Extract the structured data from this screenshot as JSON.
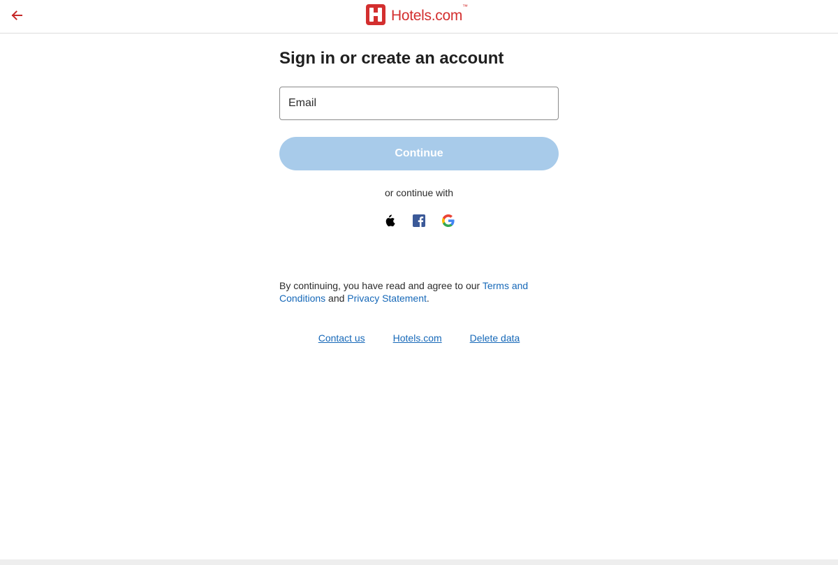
{
  "header": {
    "logo_text": "Hotels.com",
    "logo_tm": "™",
    "back_icon": "arrow-left-icon",
    "brand_color": "#d32f2f"
  },
  "main": {
    "title": "Sign in or create an account",
    "email": {
      "placeholder": "Email",
      "value": ""
    },
    "continue_label": "Continue",
    "or_text": "or continue with",
    "social": [
      "apple-icon",
      "facebook-icon",
      "google-icon"
    ],
    "legal": {
      "prefix": "By continuing, you have read and agree to our ",
      "terms_link": "Terms and Conditions",
      "and": " and ",
      "privacy_link": "Privacy Statement",
      "suffix": "."
    }
  },
  "footer": {
    "links": [
      "Contact us",
      "Hotels.com",
      "Delete data"
    ]
  },
  "colors": {
    "accent": "#d32f2f",
    "link": "#1668b8",
    "button_disabled": "#a8cbea"
  }
}
